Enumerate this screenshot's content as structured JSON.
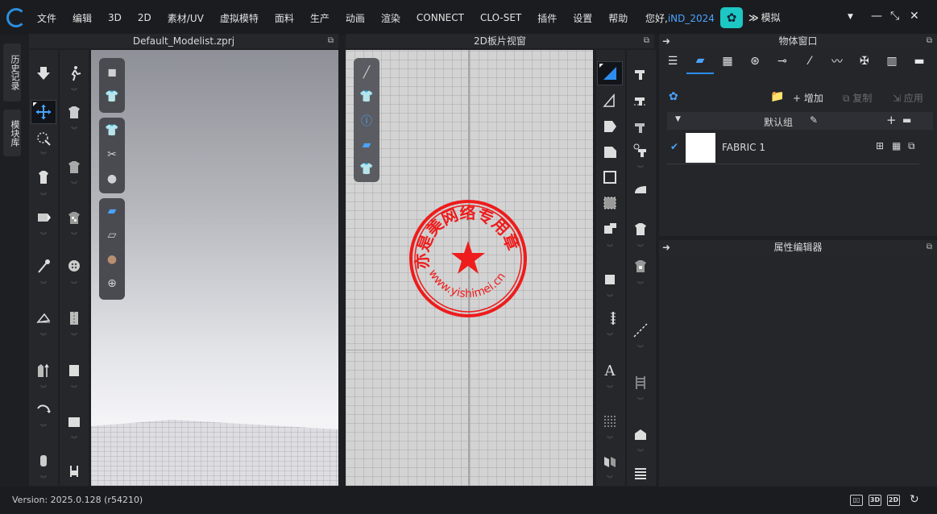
{
  "menubar": {
    "items": [
      "文件",
      "编辑",
      "3D",
      "2D",
      "素材/UV",
      "虚拟模特",
      "面料",
      "生产",
      "动画",
      "渲染",
      "CONNECT",
      "CLO-SET",
      "插件",
      "设置",
      "帮助"
    ],
    "greeting": "您好,",
    "username": "iND_2024",
    "mode_label": "模拟"
  },
  "side_tabs": [
    "历史记录",
    "模块库"
  ],
  "panel_3d": {
    "title": "Default_Modelist.zprj"
  },
  "panel_2d": {
    "title": "2D板片视窗"
  },
  "stamp": {
    "arc_text": "亦是美网络专用章",
    "url_text": "www.yishimei.cn",
    "color": "#ee1c1c"
  },
  "object_window": {
    "title": "物体窗口",
    "tabs": [
      "list-icon",
      "fabric-icon",
      "checker-icon",
      "button-icon",
      "buttonhole-icon",
      "topstitch-icon",
      "puckering-icon",
      "trim-icon",
      "zipper-icon",
      "measure-icon"
    ],
    "add_label": "增加",
    "copy_label": "复制",
    "apply_label": "应用",
    "group_label": "默认组",
    "fabrics": [
      {
        "name": "FABRIC 1",
        "color": "#ffffff",
        "checked": true
      }
    ]
  },
  "attribute_editor": {
    "title": "属性编辑器"
  },
  "statusbar": {
    "version": "Version: 2025.0.128 (r54210)",
    "btn_3d": "3D",
    "btn_2d": "2D"
  },
  "colors": {
    "accent": "#2d8ef0",
    "bg": "#1e1f22",
    "panel": "#25262a"
  }
}
